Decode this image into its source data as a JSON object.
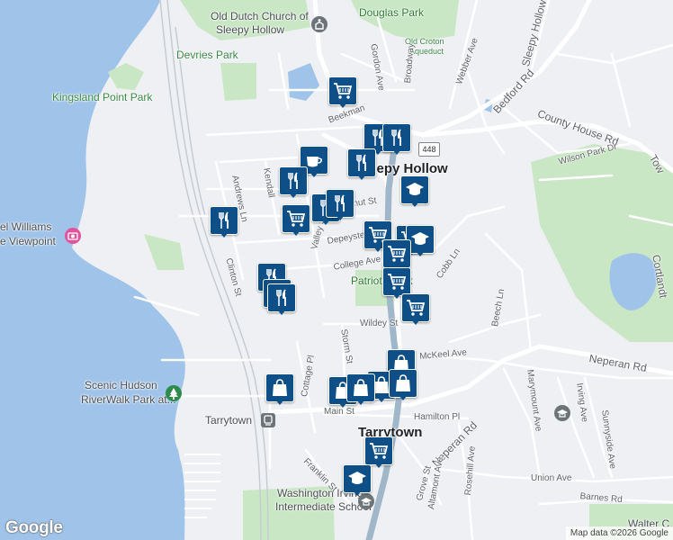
{
  "map": {
    "attribution": "Map data ©2026 Google",
    "logo": "Google",
    "colors": {
      "water": "#a0c4e9",
      "park": "#c9e7c4",
      "land": "#eef0f3",
      "road": "#ffffff",
      "highway": "#9fb7c9",
      "pin": "#0d4f86"
    },
    "labels": {
      "old_dutch_1": "Old Dutch Church of",
      "old_dutch_2": "Sleepy Hollow",
      "douglas_park": "Douglas Park",
      "old_croton_1": "Old Croton",
      "old_croton_2": "Aqueduct",
      "devries_park": "Devries Park",
      "kingsland": "Kingsland Point Park",
      "sleepy_hollow_town": "Sleepy Hollow",
      "daniel_williams_1": "el Williams",
      "daniel_williams_2": "e Viewpoint",
      "patriots_park": "Patriots Park",
      "scenic_hudson_1": "Scenic Hudson",
      "scenic_hudson_2": "RiverWalk Park at...",
      "tarrytown_station": "Tarrytown",
      "tarrytown_town": "Tarrytown",
      "wash_irving_1": "Washington Irving",
      "wash_irving_2": "Intermediate School",
      "walter": "Walter C. Jo",
      "route": "448"
    },
    "streets": {
      "gordon_ave": "Gordon Ave",
      "sleepy_hollow_rd": "Sleepy Hollow",
      "bedford_rd": "Bedford Rd",
      "webber_ave": "Webber Ave",
      "county_house_rd": "County House Rd",
      "broadway": "Broadway",
      "wilson_park_dr": "Wilson Park Dr",
      "beekman": "Beekman",
      "andrews_ln": "Andrews Ln",
      "kendall": "Kendall",
      "chestnut": "Chestnut St",
      "depeyster": "Depeyster",
      "valley_st": "Valley St",
      "college_ave": "College Ave",
      "cobb_ln": "Cobb Ln",
      "clinton_st": "Clinton St",
      "beach_ln": "Beech Ln",
      "wildey_st": "Wildey St",
      "mckeel_ave": "McKeel Ave",
      "neperan_rd_e": "Neperan Rd",
      "marymount_ave": "Marymount Ave",
      "irving_ave": "Irving Ave",
      "sunnyside_ave": "Sunnyside Ave",
      "cottage_pl": "Cottage Pl",
      "storm_st": "Storm St",
      "main_st": "Main St",
      "hamilton_pl": "Hamilton Pl",
      "neperan_rd_w": "Neperan Rd",
      "grove_st": "Grove St",
      "altamont_ave": "Altamont Ave",
      "rosehill_ave": "Rosehill Ave",
      "union_ave": "Union Ave",
      "barnes_rd": "Barnes Rd",
      "franklin_st": "Franklin St",
      "towr": "Tow",
      "cortlandt": "Cortlandt"
    },
    "markers": [
      {
        "type": "grocery"
      },
      {
        "type": "restaurant"
      },
      {
        "type": "grocery"
      },
      {
        "type": "restaurant"
      },
      {
        "type": "restaurant"
      },
      {
        "type": "cafe"
      },
      {
        "type": "restaurant"
      },
      {
        "type": "restaurant"
      },
      {
        "type": "restaurant"
      },
      {
        "type": "grocery"
      },
      {
        "type": "restaurant"
      },
      {
        "type": "school"
      },
      {
        "type": "grocery"
      },
      {
        "type": "school"
      },
      {
        "type": "grocery"
      },
      {
        "type": "grocery"
      },
      {
        "type": "grocery"
      },
      {
        "type": "restaurant"
      },
      {
        "type": "restaurant"
      },
      {
        "type": "restaurant"
      },
      {
        "type": "shopping"
      },
      {
        "type": "shopping"
      },
      {
        "type": "shopping"
      },
      {
        "type": "shopping"
      },
      {
        "type": "shopping"
      },
      {
        "type": "shopping"
      },
      {
        "type": "grocery"
      },
      {
        "type": "school"
      }
    ]
  }
}
